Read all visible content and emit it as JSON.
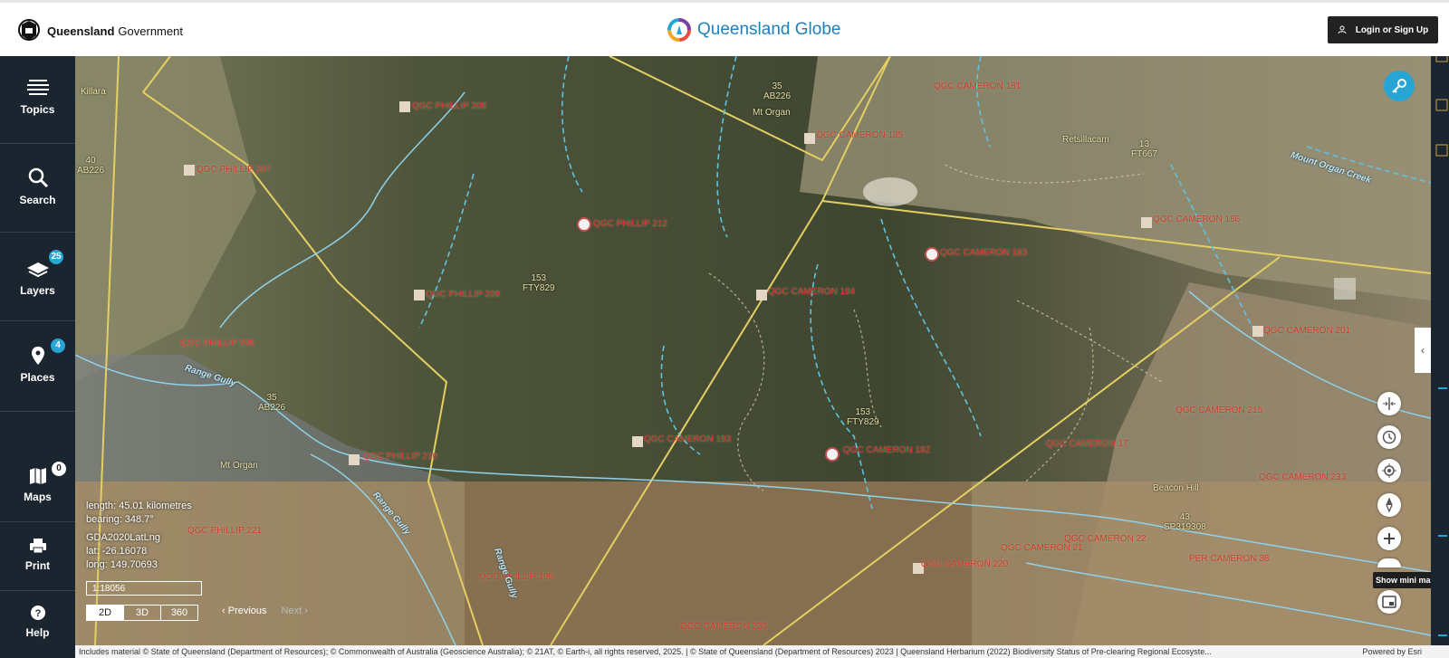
{
  "header": {
    "gov_brand_bold": "Queensland",
    "gov_brand_rest": "Government",
    "app_title": "Queensland Globe",
    "login_label": "Login or Sign Up"
  },
  "sidebar": {
    "items": [
      {
        "label": "Topics",
        "icon": "topics-icon"
      },
      {
        "label": "Search",
        "icon": "search-icon"
      },
      {
        "label": "Layers",
        "icon": "layers-icon",
        "badge": "25"
      },
      {
        "label": "Places",
        "icon": "pin-icon",
        "badge": "4"
      },
      {
        "label": "Maps",
        "icon": "map-icon",
        "badge": "0"
      },
      {
        "label": "Print",
        "icon": "print-icon"
      },
      {
        "label": "Help",
        "icon": "help-icon"
      }
    ]
  },
  "map": {
    "place_labels": [
      "Killara",
      "Mt Organ",
      "Retsillacam",
      "Mt Organ",
      "Beacon Hill"
    ],
    "parcel_labels": [
      "40\nAB226",
      "35\nAB226",
      "153\nFTY829",
      "35\nAB226",
      "13\nFT667",
      "153\nFTY829",
      "43\nSP319308"
    ],
    "well_labels": [
      "QGC PHILLIP 208",
      "QGC CAMERON 181",
      "QGC PHILLIP 207",
      "QGC CAMERON 185",
      "QGC PHILLIP 212",
      "QGC CAMERON 186",
      "QGC PHILLIP 209",
      "QGC CAMERON 183",
      "QGC CAMERON 194",
      "QGC PHILLIP 206",
      "QGC CAMERON 201",
      "QGC PHILLIP 210",
      "QGC CAMERON 193",
      "QGC CAMERON 182",
      "QGC CAMERON 215",
      "QGC CAMERON 17",
      "QGC CAMERON 233",
      "QGC PHILLIP 221",
      "QGC CAMERON 21",
      "QGC CAMERON 22",
      "QGC CAMERON 220",
      "PER CAMERON 38",
      "QGC PHILLIP 199",
      "QGC CAMERON 232"
    ],
    "water_labels": [
      "Range Gully",
      "Range Gully",
      "Mount Organ Creek",
      "Range Gully"
    ],
    "measure": {
      "length": "length: 45.01 kilometres",
      "bearing": "bearing: 348.7°",
      "crs": "GDA2020LatLng",
      "lat": "lat: -26.16078",
      "long": "long: 149.70693"
    },
    "scale": "1:18056",
    "view_modes": [
      "2D",
      "3D",
      "360"
    ],
    "active_mode": "2D",
    "pager": {
      "prev": "Previous",
      "next": "Next"
    },
    "tooltip": "Show mini map"
  },
  "attribution": {
    "text": "Includes material © State of Queensland (Department of Resources); © Commonwealth of Australia (Geoscience Australia); © 21AT, © Earth-i, all rights reserved, 2025. | © State of Queensland (Department of Resources) 2023 | Queensland Herbarium (2022) Biodiversity Status of Pre-clearing Regional Ecosyste...",
    "powered": "Powered by Esri"
  },
  "colors": {
    "sidebar": "#1b2530",
    "accent": "#27a6d6",
    "title": "#1f7fb8"
  }
}
